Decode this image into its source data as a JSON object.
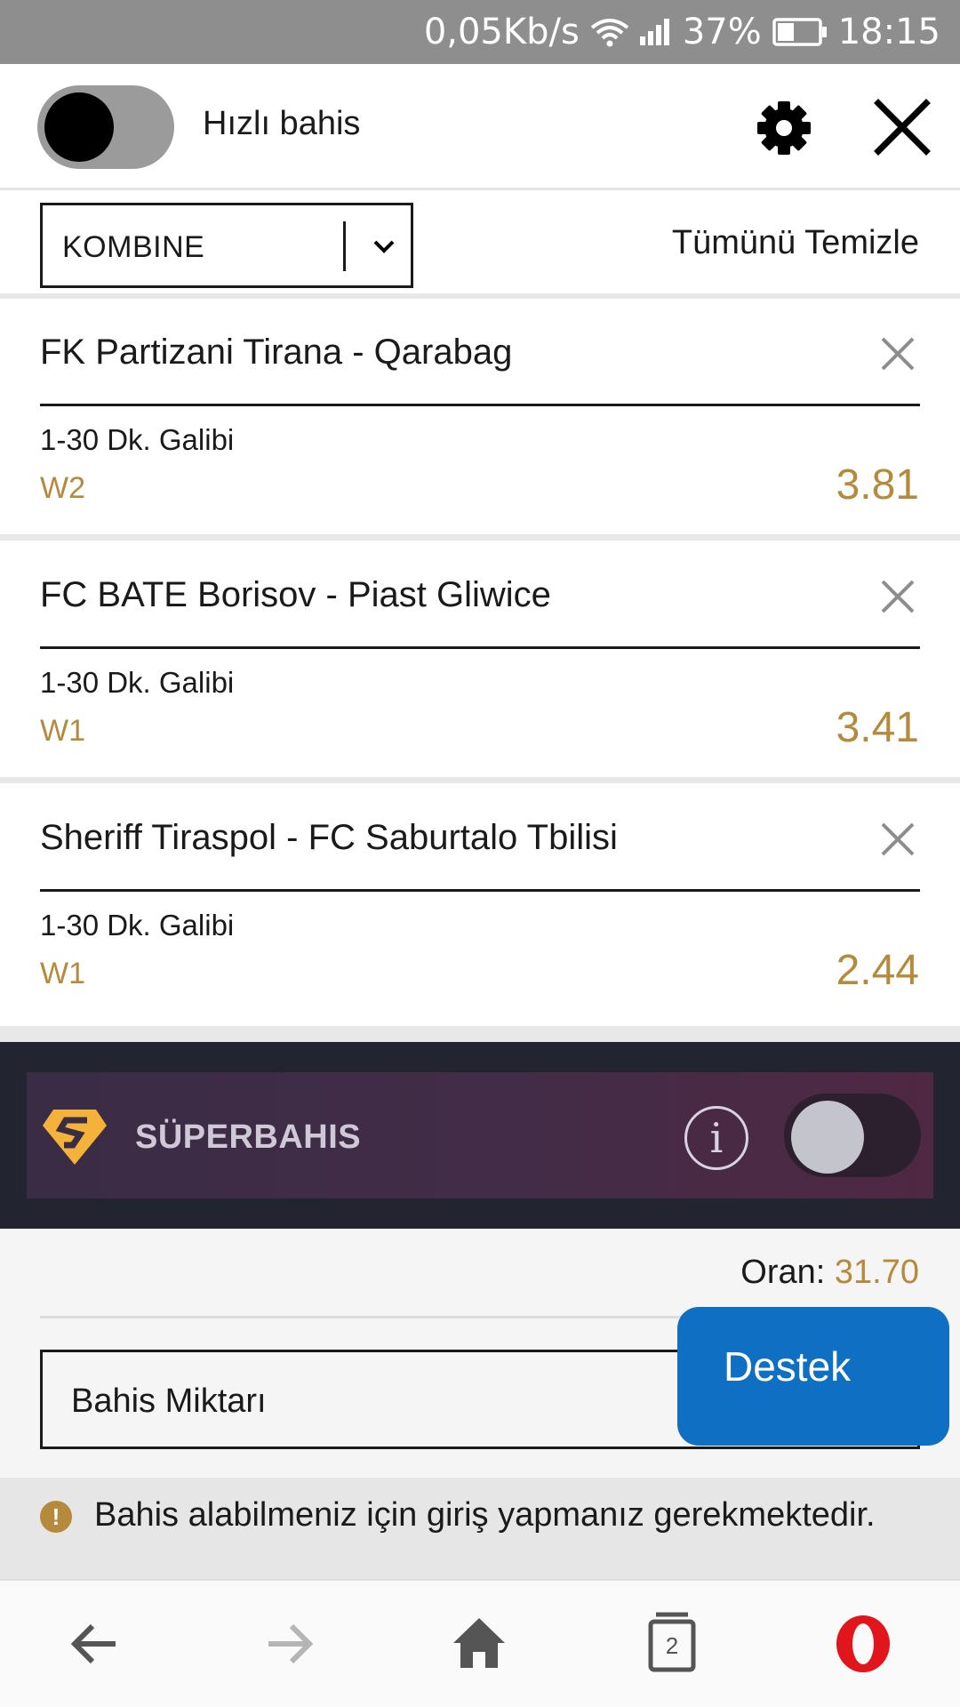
{
  "status_bar": {
    "speed": "0,05Kb/s",
    "battery": "37%",
    "time": "18:15"
  },
  "header": {
    "quick_bet_label": "Hızlı bahis"
  },
  "bet_type": {
    "selected": "KOMBINE",
    "clear_all": "Tümünü Temizle"
  },
  "bets": [
    {
      "match": "FK Partizani Tirana - Qarabag",
      "market": "1-30 Dk. Galibi",
      "pick": "W2",
      "odd": "3.81"
    },
    {
      "match": "FC BATE Borisov - Piast Gliwice",
      "market": "1-30 Dk. Galibi",
      "pick": "W1",
      "odd": "3.41"
    },
    {
      "match": "Sheriff Tiraspol - FC Saburtalo Tbilisi",
      "market": "1-30 Dk. Galibi",
      "pick": "W1",
      "odd": "2.44"
    }
  ],
  "superbet": {
    "label": "SÜPERBAHIS",
    "info": "i"
  },
  "summary": {
    "odds_label": "Oran:",
    "odds_value": "31.70",
    "stake_placeholder": "Bahis Miktarı"
  },
  "support_button": "Destek",
  "warning": {
    "icon": "!",
    "text": "Bahis alabilmeniz için giriş yapmanız gerekmektedir."
  },
  "bottom_nav": {
    "tabs_count": "2"
  },
  "colors": {
    "accent_gold": "#b58a3c",
    "support_blue": "#0f6fc3",
    "superbet_dark": "#22252f"
  }
}
